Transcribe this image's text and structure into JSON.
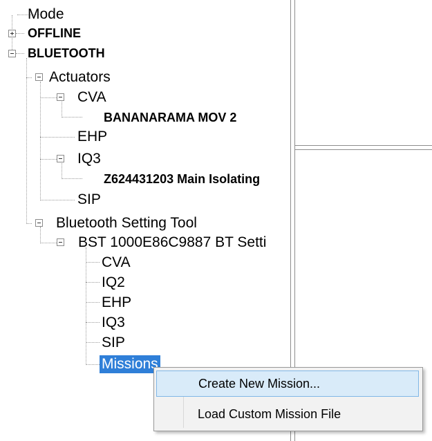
{
  "tree": {
    "mode": "Mode",
    "offline": "OFFLINE",
    "bluetooth": "BLUETOOTH",
    "actuators": "Actuators",
    "cva": "CVA",
    "cva_device": "BANANARAMA MOV 2",
    "ehp": "EHP",
    "iq3": "IQ3",
    "iq3_device": "Z624431203 Main Isolating",
    "sip": "SIP",
    "bst_tool": "Bluetooth Setting Tool",
    "bst_device": "BST 1000E86C9887 BT Setti",
    "bst_children": [
      "CVA",
      "IQ2",
      "EHP",
      "IQ3",
      "SIP"
    ],
    "missions": "Missions"
  },
  "context_menu": {
    "items": [
      "Create New Mission...",
      "Load Custom Mission File"
    ]
  },
  "colors": {
    "selection": "#2f7fd8",
    "menu_hover": "#d9ebf9"
  }
}
